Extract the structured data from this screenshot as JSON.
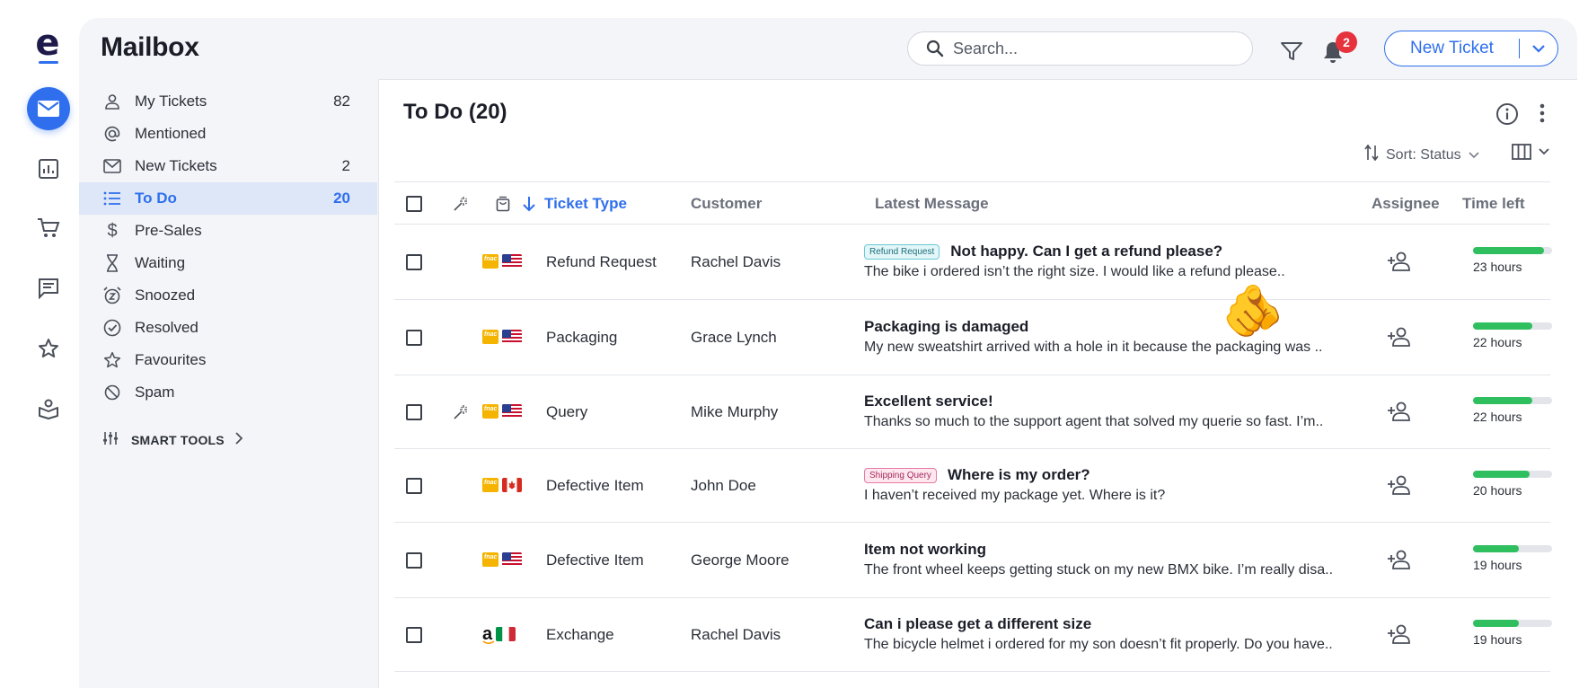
{
  "app": {
    "logo": "e"
  },
  "header": {
    "title": "Mailbox",
    "search_placeholder": "Search...",
    "notification_count": "2",
    "new_ticket_label": "New Ticket"
  },
  "sidebar": {
    "items": [
      {
        "label": "My Tickets",
        "count": "82",
        "icon": "user-icon"
      },
      {
        "label": "Mentioned",
        "count": "",
        "icon": "at-icon"
      },
      {
        "label": "New Tickets",
        "count": "2",
        "icon": "envelope-icon"
      },
      {
        "label": "To Do",
        "count": "20",
        "icon": "list-icon",
        "active": true
      },
      {
        "label": "Pre-Sales",
        "count": "",
        "icon": "dollar-icon"
      },
      {
        "label": "Waiting",
        "count": "",
        "icon": "hourglass-icon"
      },
      {
        "label": "Snoozed",
        "count": "",
        "icon": "snooze-icon"
      },
      {
        "label": "Resolved",
        "count": "",
        "icon": "check-circle-icon"
      },
      {
        "label": "Favourites",
        "count": "",
        "icon": "star-icon"
      },
      {
        "label": "Spam",
        "count": "",
        "icon": "block-icon"
      }
    ],
    "smart_tools_label": "SMART TOOLS"
  },
  "panel": {
    "title": "To Do (20)",
    "sort_label": "Sort: Status"
  },
  "table": {
    "headers": {
      "ticket_type": "Ticket Type",
      "customer": "Customer",
      "latest_message": "Latest Message",
      "assignee": "Assignee",
      "time_left": "Time left"
    },
    "rows": [
      {
        "ai": false,
        "brand": "fnac",
        "flag": "us",
        "type": "Refund Request",
        "customer": "Rachel Davis",
        "tag": "Refund Request",
        "tag_kind": "refund",
        "subject": "Not happy. Can I get a refund please?",
        "snippet": "The bike i ordered isn’t the right size. I would like a refund please..",
        "progress": 0.9,
        "time_left": "23 hours"
      },
      {
        "ai": false,
        "brand": "fnac",
        "flag": "us",
        "type": "Packaging",
        "customer": "Grace Lynch",
        "tag": "",
        "tag_kind": "",
        "subject": "Packaging is damaged",
        "snippet": "My new sweatshirt arrived with a hole in it because the packaging was ..",
        "progress": 0.75,
        "time_left": "22 hours"
      },
      {
        "ai": true,
        "brand": "fnac",
        "flag": "us",
        "type": "Query",
        "customer": "Mike Murphy",
        "tag": "",
        "tag_kind": "",
        "subject": "Excellent service!",
        "snippet": "Thanks so much to the support agent that solved my querie so fast. I’m..",
        "progress": 0.75,
        "time_left": "22 hours"
      },
      {
        "ai": false,
        "brand": "fnac",
        "flag": "ca",
        "type": "Defective Item",
        "customer": "John Doe",
        "tag": "Shipping Query",
        "tag_kind": "ship",
        "subject": "Where is my order?",
        "snippet": "I haven’t received my package yet. Where is it?",
        "progress": 0.72,
        "time_left": "20 hours"
      },
      {
        "ai": false,
        "brand": "fnac",
        "flag": "us",
        "type": "Defective Item",
        "customer": "George Moore",
        "tag": "",
        "tag_kind": "",
        "subject": "Item not working",
        "snippet": "The front wheel keeps getting stuck on my new BMX bike. I’m really disa..",
        "progress": 0.58,
        "time_left": "19 hours"
      },
      {
        "ai": false,
        "brand": "amazon",
        "flag": "it",
        "type": "Exchange",
        "customer": "Rachel Davis",
        "tag": "",
        "tag_kind": "",
        "subject": "Can i please get a different size",
        "snippet": "The bicycle helmet i ordered for my son doesn’t fit properly. Do you have..",
        "progress": 0.58,
        "time_left": "19 hours"
      }
    ]
  },
  "colors": {
    "accent": "#2f6fed",
    "progress": "#2fbf5f",
    "badge": "#e5323c"
  }
}
